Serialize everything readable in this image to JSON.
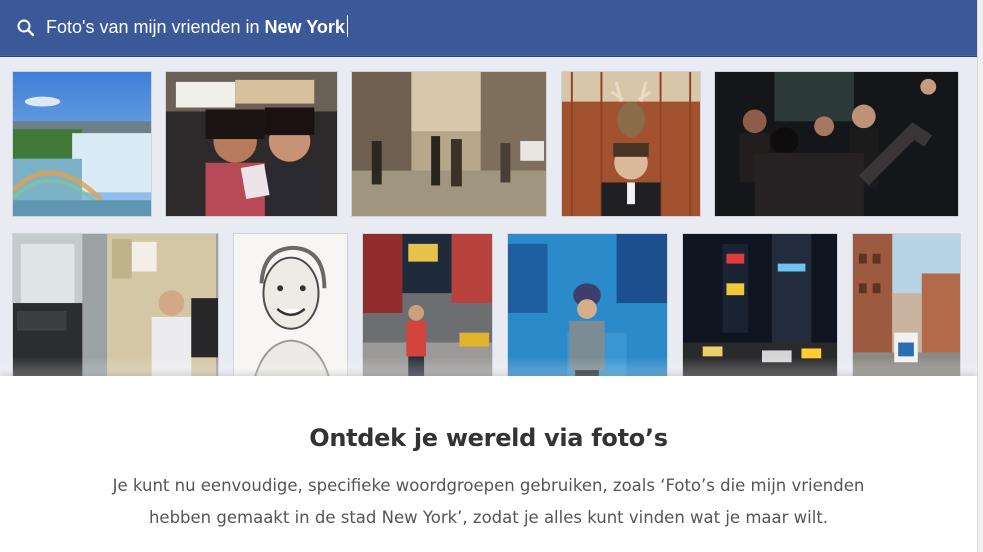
{
  "search": {
    "query_prefix": "Foto's van mijn vrienden in ",
    "query_bold": "New York"
  },
  "photos": [
    {
      "name": "photo-niagara-falls-rainbow"
    },
    {
      "name": "photo-two-women-tourist-signs"
    },
    {
      "name": "photo-city-street-pedestrians"
    },
    {
      "name": "photo-man-with-deer-trophy"
    },
    {
      "name": "photo-people-dancing-party"
    },
    {
      "name": "photo-man-at-desk-office"
    },
    {
      "name": "photo-smiling-woman-sketch"
    },
    {
      "name": "photo-woman-times-square-day"
    },
    {
      "name": "photo-woman-blue-wall"
    },
    {
      "name": "photo-times-square-night"
    },
    {
      "name": "photo-brick-buildings-street"
    }
  ],
  "promo": {
    "title": "Ontdek je wereld via foto’s",
    "description": "Je kunt nu eenvoudige, specifieke woordgroepen gebruiken, zoals ‘Foto’s die mijn vrienden hebben gemaakt in de stad New York’, zodat je alles kunt vinden wat je maar wilt."
  },
  "colors": {
    "header": "#3b5998",
    "grid_background": "#e9ebf2"
  }
}
